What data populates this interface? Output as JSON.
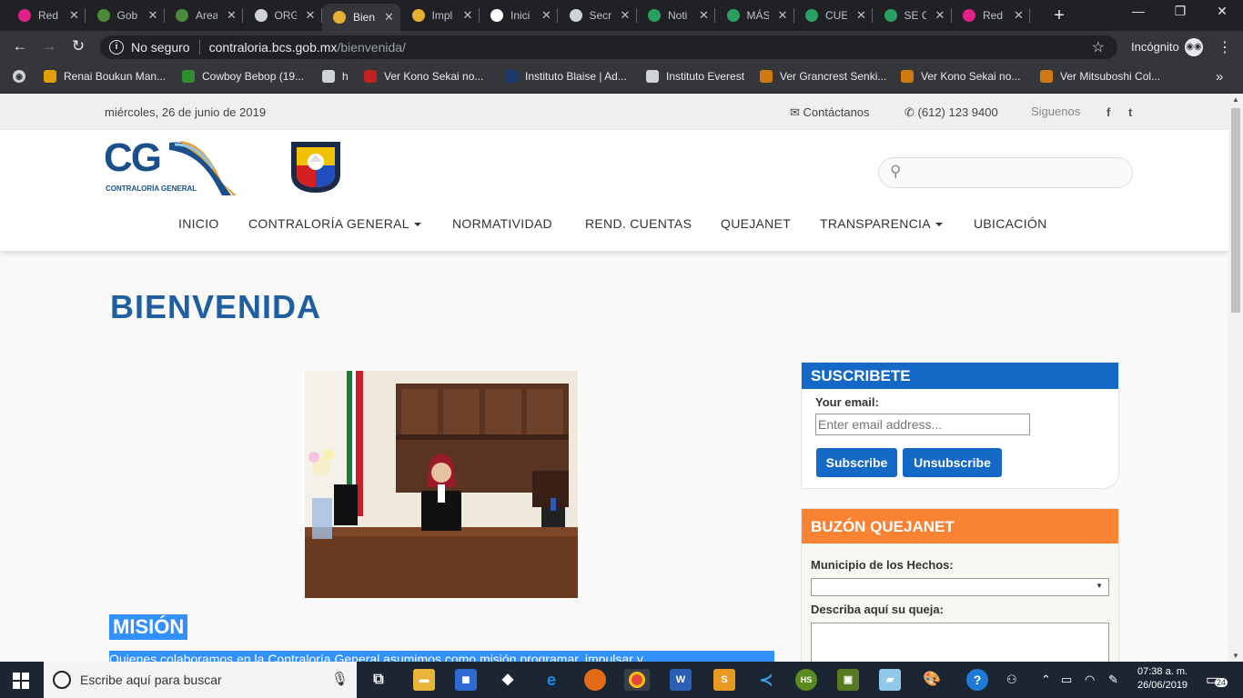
{
  "browser": {
    "tabs": [
      {
        "title": "Red",
        "color": "#e0218a"
      },
      {
        "title": "Gob",
        "color": "#4a8a3a"
      },
      {
        "title": "Area",
        "color": "#4a8a3a"
      },
      {
        "title": "ORG",
        "color": "#cfd2d6"
      },
      {
        "title": "Bien",
        "color": "#e8b030"
      },
      {
        "title": "Impl",
        "color": "#e8b030"
      },
      {
        "title": "Inici",
        "color": "#ffffff"
      },
      {
        "title": "Secr",
        "color": "#cfd2d6"
      },
      {
        "title": "Noti",
        "color": "#2aa060"
      },
      {
        "title": "MÁS",
        "color": "#2aa060"
      },
      {
        "title": "CUE",
        "color": "#2aa060"
      },
      {
        "title": "SE C",
        "color": "#2aa060"
      },
      {
        "title": "Red",
        "color": "#e0218a"
      }
    ],
    "active_tab_index": 4,
    "url_security": "No seguro",
    "url_host": "contraloria.bcs.gob.mx",
    "url_path": "/bienvenida/",
    "mode_label": "Incógnito",
    "bookmarks": [
      {
        "label": "Renai Boukun Man...",
        "icon": "book-icon",
        "color": "#e0a000"
      },
      {
        "label": "Cowboy Bebop (19...",
        "icon": "jk-icon",
        "color": "#2f8f2f"
      },
      {
        "label": "h",
        "icon": "globe-icon",
        "color": "#cfd2d6"
      },
      {
        "label": "Ver Kono Sekai no...",
        "icon": "red-swoosh-icon",
        "color": "#c02020"
      },
      {
        "label": "Instituto Blaise | Ad...",
        "icon": "ib-icon",
        "color": "#1b3a6b"
      },
      {
        "label": "Instituto Everest",
        "icon": "globe-icon",
        "color": "#cfd2d6"
      },
      {
        "label": "Ver Grancrest Senki...",
        "icon": "af-icon",
        "color": "#d07a10"
      },
      {
        "label": "Ver Kono Sekai no...",
        "icon": "af-icon",
        "color": "#d07a10"
      },
      {
        "label": "Ver Mitsuboshi Col...",
        "icon": "af-icon",
        "color": "#d07a10"
      }
    ]
  },
  "site": {
    "date": "miércoles, 26 de junio de 2019",
    "contact": "Contáctanos",
    "phone": "(612) 123 9400",
    "follow": "Siguenos",
    "facebook": "f",
    "twitter": "t",
    "logo_text": "CG",
    "logo_subtitle": "CONTRALORÍA GENERAL",
    "nav": [
      {
        "label": "INICIO",
        "dropdown": false
      },
      {
        "label": "CONTRALORÍA GENERAL",
        "dropdown": true
      },
      {
        "label": "NORMATIVIDAD",
        "dropdown": false
      },
      {
        "label": "REND. CUENTAS",
        "dropdown": false
      },
      {
        "label": "QUEJANET",
        "dropdown": false
      },
      {
        "label": "TRANSPARENCIA",
        "dropdown": true
      },
      {
        "label": "UBICACIÓN",
        "dropdown": false
      }
    ],
    "page_title": "BIENVENIDA",
    "mision_title": "MISIÓN",
    "mision_text": "Quienes colaboramos en la Contraloría General asumimos como misión programar, impulsar y",
    "subscribe": {
      "title": "SUSCRIBETE",
      "email_label": "Your email:",
      "email_placeholder": "Enter email address...",
      "subscribe_btn": "Subscribe",
      "unsubscribe_btn": "Unsubscribe"
    },
    "quejanet": {
      "title": "BUZÓN QUEJANET",
      "municipio_label": "Municipio de los Hechos:",
      "queja_label": "Describa aquí su queja:"
    },
    "colors": {
      "primary": "#1469c7",
      "accent": "#fa8233",
      "title": "#1f5fa0"
    }
  },
  "taskbar": {
    "search_placeholder": "Escribe aquí para buscar",
    "time": "07:38 a. m.",
    "date": "26/06/2019",
    "notifications": "24"
  }
}
